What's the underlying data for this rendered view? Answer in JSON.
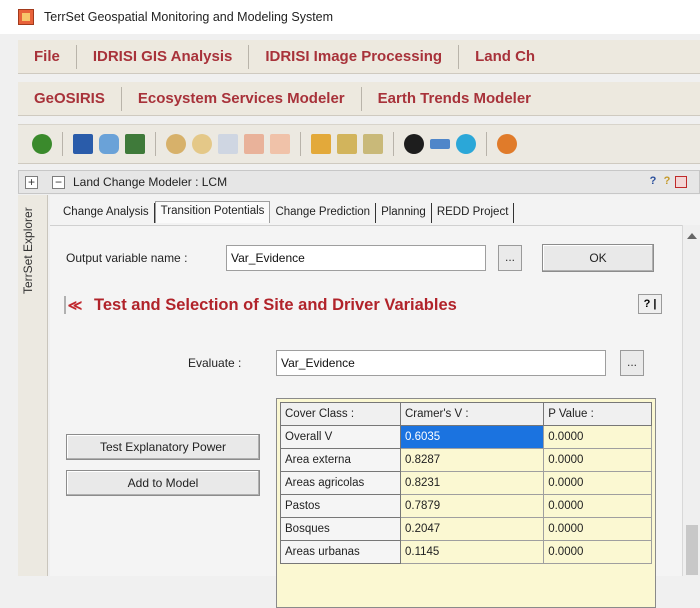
{
  "window": {
    "title": "TerrSet Geospatial Monitoring and Modeling System"
  },
  "menu_row1": [
    "File",
    "IDRISI GIS Analysis",
    "IDRISI Image Processing",
    "Land Ch"
  ],
  "menu_row2": [
    "GeOSIRIS",
    "Ecosystem Services Modeler",
    "Earth Trends Modeler"
  ],
  "explorer": {
    "label": "TerrSet Explorer",
    "expand": "+"
  },
  "panel": {
    "collapse": "−",
    "title": "Land Change Modeler : LCM",
    "ctrl_help1": "?",
    "ctrl_help2": "?"
  },
  "tabs": [
    "Change Analysis",
    "Transition Potentials",
    "Change Prediction",
    "Planning",
    "REDD Project"
  ],
  "active_tab": "Transition Potentials",
  "output": {
    "label": "Output variable name :",
    "value": "Var_Evidence",
    "browse": "...",
    "ok": "OK"
  },
  "section": {
    "chevron": "≪",
    "title": "Test and Selection of Site and Driver Variables",
    "help": "? |"
  },
  "evaluate": {
    "label": "Evaluate :",
    "value": "Var_Evidence",
    "browse": "..."
  },
  "buttons": {
    "test": "Test Explanatory Power",
    "add": "Add to Model"
  },
  "table": {
    "headers": [
      "Cover Class :",
      "Cramer's V :",
      "P Value :"
    ],
    "rows": [
      [
        "Overall V",
        "0.6035",
        "0.0000"
      ],
      [
        "Area externa",
        "0.8287",
        "0.0000"
      ],
      [
        "Areas agricolas",
        "0.8231",
        "0.0000"
      ],
      [
        "Pastos",
        "0.7879",
        "0.0000"
      ],
      [
        "Bosques",
        "0.2047",
        "0.0000"
      ],
      [
        "Areas urbanas",
        "0.1145",
        "0.0000"
      ]
    ]
  },
  "colors": {
    "menu_text": "#a8323a",
    "section_title": "#b1232a",
    "table_bg": "#fbf8d2",
    "selection": "#1b73e0"
  }
}
